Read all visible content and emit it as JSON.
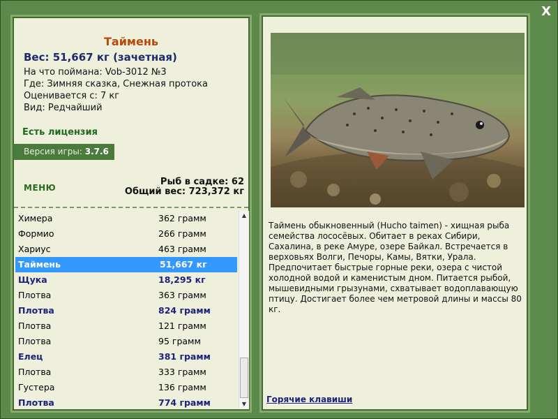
{
  "window": {
    "close_label": "X"
  },
  "catch": {
    "title": "Таймень",
    "weight": "Вес: 51,667 кг (зачетная)",
    "caught_on": "На что поймана: Vob-3012 №3",
    "where": "Где: Зимняя сказка, Снежная протока",
    "valued_from": "Оценивается с: 7 кг",
    "kind": "Вид: Редчайший"
  },
  "license": "Есть лицензия",
  "version": {
    "label": "Версия игры:",
    "value": "3.7.6"
  },
  "menu_label": "МЕНЮ",
  "stats": {
    "fish_count": "Рыб в садке: 62",
    "total_weight": "Общий вес: 723,372 кг"
  },
  "fish_list": [
    {
      "name": "Химера",
      "weight": "362 грамм",
      "bold": false,
      "selected": false
    },
    {
      "name": "Формио",
      "weight": "266 грамм",
      "bold": false,
      "selected": false
    },
    {
      "name": "Хариус",
      "weight": "463 грамм",
      "bold": false,
      "selected": false
    },
    {
      "name": "Таймень",
      "weight": "51,667 кг",
      "bold": true,
      "selected": true
    },
    {
      "name": "Щука",
      "weight": "18,295 кг",
      "bold": true,
      "selected": false
    },
    {
      "name": "Плотва",
      "weight": "363 грамм",
      "bold": false,
      "selected": false
    },
    {
      "name": "Плотва",
      "weight": "824 грамм",
      "bold": true,
      "selected": false
    },
    {
      "name": "Плотва",
      "weight": "121 грамм",
      "bold": false,
      "selected": false
    },
    {
      "name": "Плотва",
      "weight": "95 грамм",
      "bold": false,
      "selected": false
    },
    {
      "name": "Елец",
      "weight": "381 грамм",
      "bold": true,
      "selected": false
    },
    {
      "name": "Плотва",
      "weight": "333 грамм",
      "bold": false,
      "selected": false
    },
    {
      "name": "Густера",
      "weight": "136 грамм",
      "bold": false,
      "selected": false
    },
    {
      "name": "Плотва",
      "weight": "774 грамм",
      "bold": true,
      "selected": false
    }
  ],
  "description": "Таймень обыкновенный (Hucho taimen) - хищная рыба семейства лососёвых. Обитает в реках Сибири, Сахалина, в реке Амуре, озере Байкал. Встречается в верховьях Волги, Печоры, Камы, Вятки, Урала. Предпочитает быстрые горные реки, озера с чистой холодной водой и каменистым дном. Питается рыбой, мышевидными грызунами, схватывает водоплавающую птицу. Достигает более чем метровой длины и массы 80 кг.",
  "hotkeys_label": "Горячие клавиши",
  "icons": {
    "close": "close-icon",
    "scroll_up": "scroll-up-icon",
    "scroll_down": "scroll-down-icon"
  }
}
